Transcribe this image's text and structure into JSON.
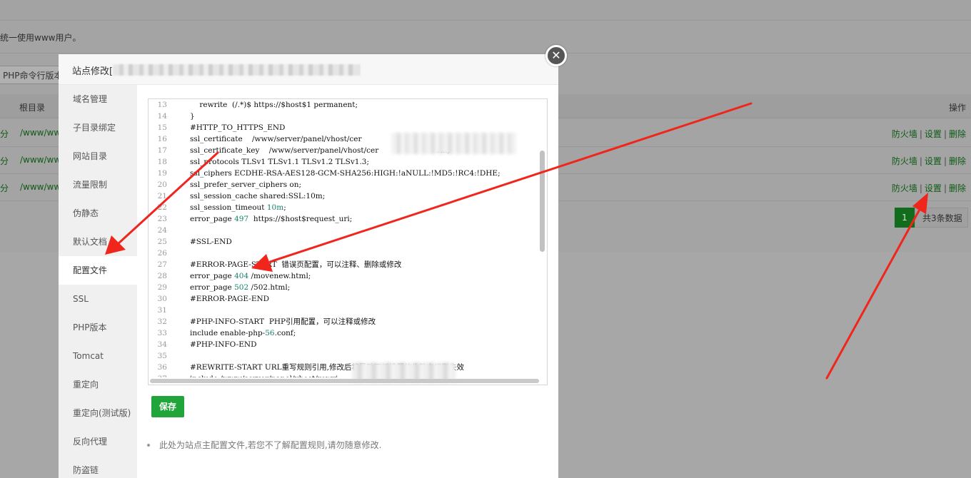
{
  "background": {
    "notice_text": "统一使用www用户。",
    "php_version_label": "PHP命令行版本",
    "table_header": {
      "root_dir": "根目录",
      "actions": "操作"
    },
    "rows": [
      {
        "left_fragment": "分",
        "path": "/www/www",
        "firewall": "防火墙",
        "settings": "设置",
        "delete": "删除",
        "sep": "|"
      },
      {
        "left_fragment": "分",
        "path": "/www/www",
        "firewall": "防火墙",
        "settings": "设置",
        "delete": "删除",
        "sep": "|"
      },
      {
        "left_fragment": "分",
        "path": "/www/www",
        "firewall": "防火墙",
        "settings": "设置",
        "delete": "删除",
        "sep": "|"
      }
    ],
    "pager": {
      "current_page": "1",
      "total": "共3条数据"
    }
  },
  "modal": {
    "title": "站点修改[",
    "close_symbol": "✕",
    "nav": [
      "域名管理",
      "子目录绑定",
      "网站目录",
      "流量限制",
      "伪静态",
      "默认文档",
      "配置文件",
      "SSL",
      "PHP版本",
      "Tomcat",
      "重定向",
      "重定向(测试版)",
      "反向代理",
      "防盗链"
    ],
    "active_nav": "配置文件",
    "editor": {
      "lines": [
        {
          "n": "13",
          "t": "    rewrite  (/.*)$ https://$host$1 permanent;"
        },
        {
          "n": "14",
          "t": "}"
        },
        {
          "n": "15",
          "t": "#HTTP_TO_HTTPS_END"
        },
        {
          "n": "16",
          "t": "ssl_certificate    /www/server/panel/vhost/cer"
        },
        {
          "n": "17",
          "t": "ssl_certificate_key    /www/server/panel/vhost/cer                        em;"
        },
        {
          "n": "18",
          "t": "ssl_protocols TLSv1 TLSv1.1 TLSv1.2 TLSv1.3;"
        },
        {
          "n": "19",
          "t": "ssl_ciphers ECDHE-RSA-AES128-GCM-SHA256:HIGH:!aNULL:!MD5:!RC4:!DHE;"
        },
        {
          "n": "20",
          "t": "ssl_prefer_server_ciphers on;"
        },
        {
          "n": "21",
          "t": "ssl_session_cache shared:SSL:10m;"
        },
        {
          "n": "22",
          "t": "ssl_session_timeout 10m;"
        },
        {
          "n": "23",
          "t": "error_page 497  https://$host$request_uri;"
        },
        {
          "n": "24",
          "t": ""
        },
        {
          "n": "25",
          "t": "#SSL-END"
        },
        {
          "n": "26",
          "t": ""
        },
        {
          "n": "27",
          "t": "#ERROR-PAGE-START  错误页配置，可以注释、删除或修改"
        },
        {
          "n": "28",
          "t": "error_page 404 /movenew.html;"
        },
        {
          "n": "29",
          "t": "error_page 502 /502.html;"
        },
        {
          "n": "30",
          "t": "#ERROR-PAGE-END"
        },
        {
          "n": "31",
          "t": ""
        },
        {
          "n": "32",
          "t": "#PHP-INFO-START  PHP引用配置，可以注释或修改"
        },
        {
          "n": "33",
          "t": "include enable-php-56.conf;"
        },
        {
          "n": "34",
          "t": "#PHP-INFO-END"
        },
        {
          "n": "35",
          "t": ""
        },
        {
          "n": "36",
          "t": "#REWRITE-START URL重写规则引用,修改后将导致面板设置的伪静态规则失效"
        },
        {
          "n": "37",
          "t": "include /www/server/panel/vhost/rewri"
        }
      ]
    },
    "save_label": "保存",
    "hint": "此处为站点主配置文件,若您不了解配置规则,请勿随意修改."
  },
  "colors": {
    "accent_green": "#20a53a",
    "annotation_red": "#f0261c",
    "link_green": "#0e5a14"
  }
}
